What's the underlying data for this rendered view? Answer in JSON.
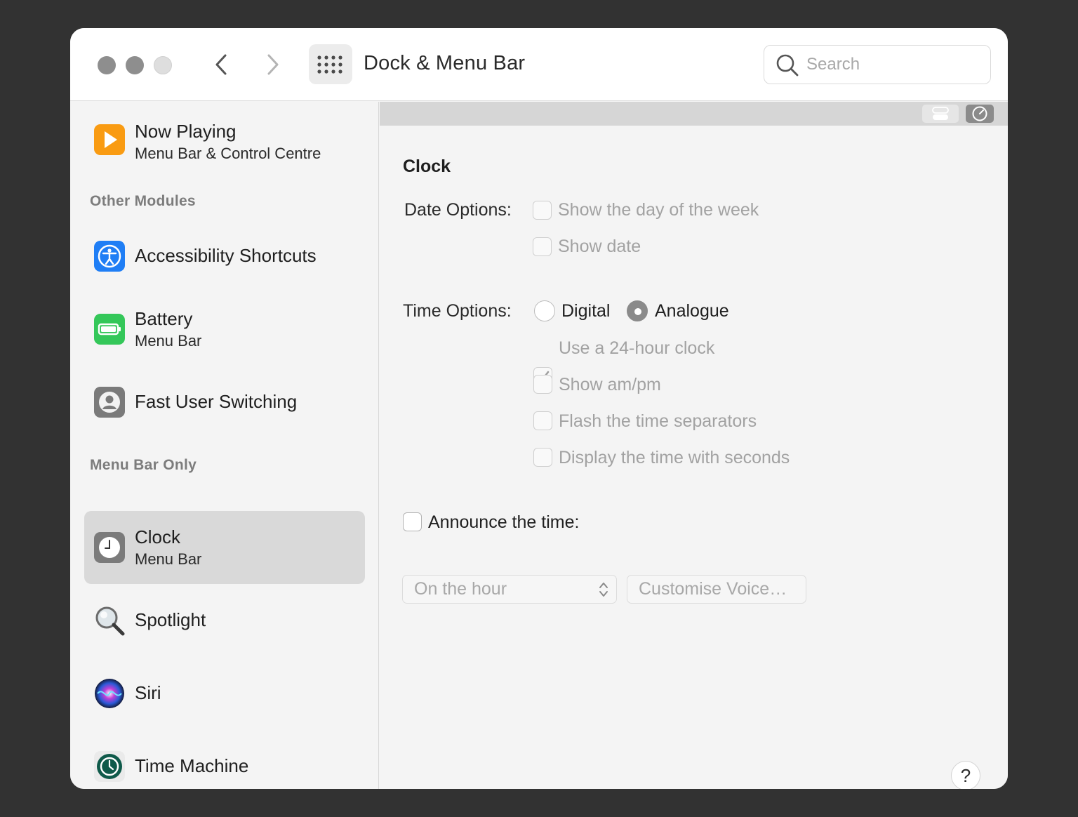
{
  "window": {
    "title": "Dock & Menu Bar",
    "search_placeholder": "Search"
  },
  "sidebar": {
    "sections": [
      {
        "header": ""
      },
      {
        "header": "Other Modules"
      },
      {
        "header": "Menu Bar Only"
      }
    ],
    "items": [
      {
        "title": "Now Playing",
        "subtitle": "Menu Bar & Control Centre",
        "icon": "now-playing-icon"
      },
      {
        "title": "Accessibility Shortcuts",
        "subtitle": "",
        "icon": "accessibility-icon"
      },
      {
        "title": "Battery",
        "subtitle": "Menu Bar",
        "icon": "battery-icon"
      },
      {
        "title": "Fast User Switching",
        "subtitle": "",
        "icon": "user-switching-icon"
      },
      {
        "title": "Clock",
        "subtitle": "Menu Bar",
        "icon": "clock-icon",
        "selected": true
      },
      {
        "title": "Spotlight",
        "subtitle": "",
        "icon": "spotlight-icon"
      },
      {
        "title": "Siri",
        "subtitle": "",
        "icon": "siri-icon"
      },
      {
        "title": "Time Machine",
        "subtitle": "",
        "icon": "time-machine-icon"
      }
    ]
  },
  "pane": {
    "heading": "Clock",
    "date_options": {
      "label": "Date Options:",
      "options": [
        {
          "label": "Show the day of the week",
          "checked": false
        },
        {
          "label": "Show date",
          "checked": false
        }
      ]
    },
    "time_options": {
      "label": "Time Options:",
      "radio": [
        {
          "label": "Digital",
          "selected": false
        },
        {
          "label": "Analogue",
          "selected": true
        }
      ],
      "options": [
        {
          "label": "Use a 24-hour clock",
          "checked": true
        },
        {
          "label": "Show am/pm",
          "checked": false
        },
        {
          "label": "Flash the time separators",
          "checked": false
        },
        {
          "label": "Display the time with seconds",
          "checked": false
        }
      ]
    },
    "announce": {
      "label": "Announce the time:",
      "checked": false,
      "interval": "On the hour",
      "voice_button": "Customise Voice…"
    },
    "help_label": "?"
  },
  "colors": {
    "window_bg": "#f4f4f4",
    "desktop_bg": "#323232",
    "selected_row": "#d9d9d9",
    "disabled_text": "#a2a2a2"
  }
}
